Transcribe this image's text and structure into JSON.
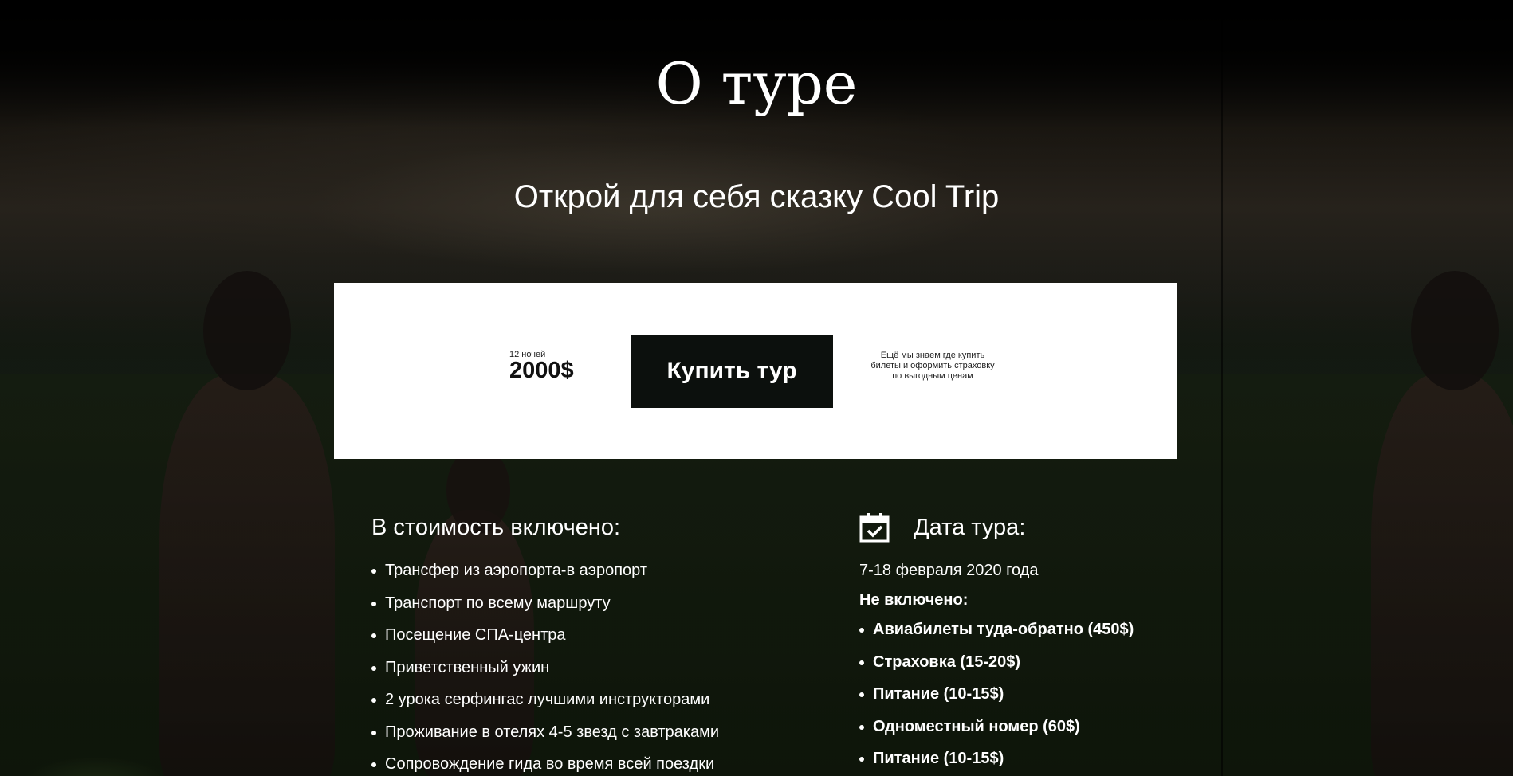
{
  "page": {
    "title": "О туре",
    "subtitle": "Открой для себя сказку Cool Trip"
  },
  "price_card": {
    "nights": "12 ночей",
    "price": "2000$",
    "buy_label": "Купить тур",
    "note": "Ещё мы знаем где купить билеты и оформить страховку по выгодным ценам"
  },
  "included": {
    "heading": "В стоимость включено:",
    "items": [
      "Трансфер из аэропорта-в аэропорт",
      "Транспорт по всему маршруту",
      "Посещение СПА-центра",
      "Приветственный ужин",
      "2 урока серфингас лучшими инструкторами",
      "Проживание в отелях 4-5 звезд с завтраками",
      "Сопровождение гида во время всей поездки"
    ]
  },
  "tour_date": {
    "icon": "calendar-check-icon",
    "heading": "Дата тура:",
    "date": "7-18 февраля 2020 года",
    "not_included_label": "Не включено:",
    "not_included": [
      "Авиабилеты туда-обратно (450$)",
      "Страховка (15-20$)",
      "Питание (10-15$)",
      "Одноместный номер (60$)",
      "Питание (10-15$)"
    ]
  },
  "colors": {
    "button_bg": "#0c100d",
    "card_bg": "#ffffff",
    "text_light": "#ffffff"
  }
}
